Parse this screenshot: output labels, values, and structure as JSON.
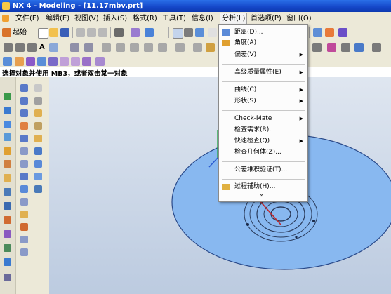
{
  "window": {
    "title": "NX 4 - Modeling - [11.17mbv.prt]"
  },
  "menubar": {
    "items": [
      {
        "label": "文件(F)"
      },
      {
        "label": "编辑(E)"
      },
      {
        "label": "视图(V)"
      },
      {
        "label": "插入(S)"
      },
      {
        "label": "格式(R)"
      },
      {
        "label": "工具(T)"
      },
      {
        "label": "信息(I)"
      },
      {
        "label": "分析(L)"
      },
      {
        "label": "首选项(P)"
      },
      {
        "label": "窗口(O)"
      }
    ]
  },
  "toolbar": {
    "start_label": "起始"
  },
  "cue_line": {
    "text": "选择对象并使用 MB3，或者双击某一对象"
  },
  "analysis_menu": {
    "items": [
      {
        "label": "距离(D)...",
        "icon": "distance-icon"
      },
      {
        "label": "角度(A)"
      },
      {
        "label": "偏差(V)",
        "submenu": true
      },
      {
        "label": "高级质量属性(E)",
        "submenu": true
      },
      {
        "label": "曲线(C)",
        "submenu": true
      },
      {
        "label": "形状(S)",
        "submenu": true
      },
      {
        "label": "Check-Mate",
        "submenu": true
      },
      {
        "label": "检查需求(R)..."
      },
      {
        "label": "快速检查(Q)",
        "submenu": true
      },
      {
        "label": "检查几何体(Z)..."
      },
      {
        "label": "公差堆积验证(T)..."
      },
      {
        "label": "过程辅助(H)...",
        "icon": "process-assist-icon"
      },
      {
        "label": "»"
      }
    ]
  },
  "colors": {
    "titlebar": "#1446c8",
    "viewport_bg": "#c8d4e6",
    "part_fill": "#88b8f0",
    "annotation_arrow": "#c0282e"
  }
}
